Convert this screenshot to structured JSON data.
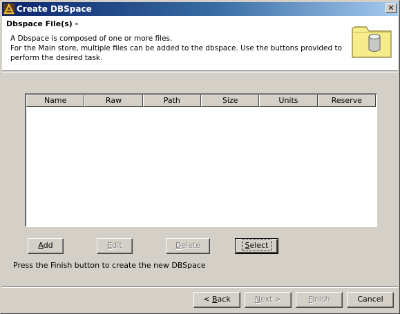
{
  "window": {
    "title": "Create DBSpace",
    "close_label": "✕"
  },
  "header": {
    "title": "Dbspace File(s) -",
    "lines": [
      "A Dbspace is composed of one or more files.",
      "For the Main store, multiple files can be added to the dbspace.  Use the buttons provided to",
      "perform the desired task."
    ],
    "icon": "folder-database-icon"
  },
  "table": {
    "columns": [
      "Name",
      "Raw",
      "Path",
      "Size",
      "Units",
      "Reserve"
    ],
    "rows": []
  },
  "file_buttons": {
    "add": {
      "prefix": "",
      "accel": "A",
      "suffix": "dd",
      "enabled": true
    },
    "edit": {
      "prefix": "",
      "accel": "E",
      "suffix": "dit",
      "enabled": false
    },
    "delete": {
      "prefix": "",
      "accel": "D",
      "suffix": "elete",
      "enabled": false
    },
    "select": {
      "prefix": "",
      "accel": "S",
      "suffix": "elect",
      "enabled": true,
      "focused": true
    }
  },
  "hint": "Press the Finish button to create the new DBSpace",
  "wizard_buttons": {
    "back": {
      "prefix": "< ",
      "accel": "B",
      "suffix": "ack",
      "enabled": true
    },
    "next": {
      "prefix": "",
      "accel": "N",
      "suffix": "ext >",
      "enabled": false
    },
    "finish": {
      "prefix": "",
      "accel": "F",
      "suffix": "inish",
      "enabled": false
    },
    "cancel": {
      "label": "Cancel",
      "enabled": true
    }
  },
  "colors": {
    "titlebar_start": "#0a246a",
    "titlebar_end": "#a6caf0",
    "face": "#d4d0c8"
  }
}
